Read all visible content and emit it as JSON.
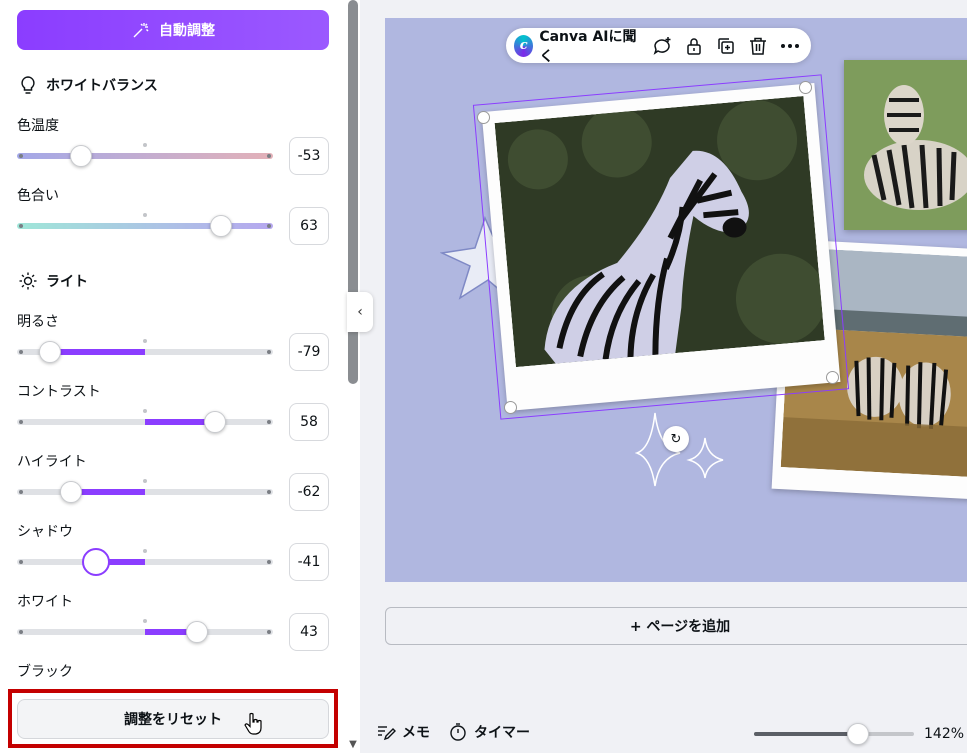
{
  "panel": {
    "auto_adjust_label": "自動調整",
    "white_balance": {
      "title": "ホワイトバランス",
      "sliders": [
        {
          "label": "色温度",
          "value": "-53",
          "level": -53
        },
        {
          "label": "色合い",
          "value": "63",
          "level": 63
        }
      ]
    },
    "light": {
      "title": "ライト",
      "sliders": [
        {
          "label": "明るさ",
          "value": "-79",
          "level": -79
        },
        {
          "label": "コントラスト",
          "value": "58",
          "level": 58
        },
        {
          "label": "ハイライト",
          "value": "-62",
          "level": -62
        },
        {
          "label": "シャドウ",
          "value": "-41",
          "level": -41
        },
        {
          "label": "ホワイト",
          "value": "43",
          "level": 43
        }
      ],
      "next_label": "ブラック"
    },
    "reset_label": "調整をリセット"
  },
  "toolbar": {
    "ai_label": "Canva AIに聞く",
    "icons": [
      "comment-add-icon",
      "lock-icon",
      "duplicate-icon",
      "trash-icon",
      "more-icon"
    ]
  },
  "canvas": {
    "add_page_label": "+ ページを追加"
  },
  "bottom_bar": {
    "memo_label": "メモ",
    "timer_label": "タイマー",
    "zoom_label": "142%",
    "zoom_level_fraction": 0.65
  },
  "colors": {
    "accent": "#8b3dff",
    "canvas_bg": "#b0b7e0",
    "highlight": "#c40000"
  }
}
